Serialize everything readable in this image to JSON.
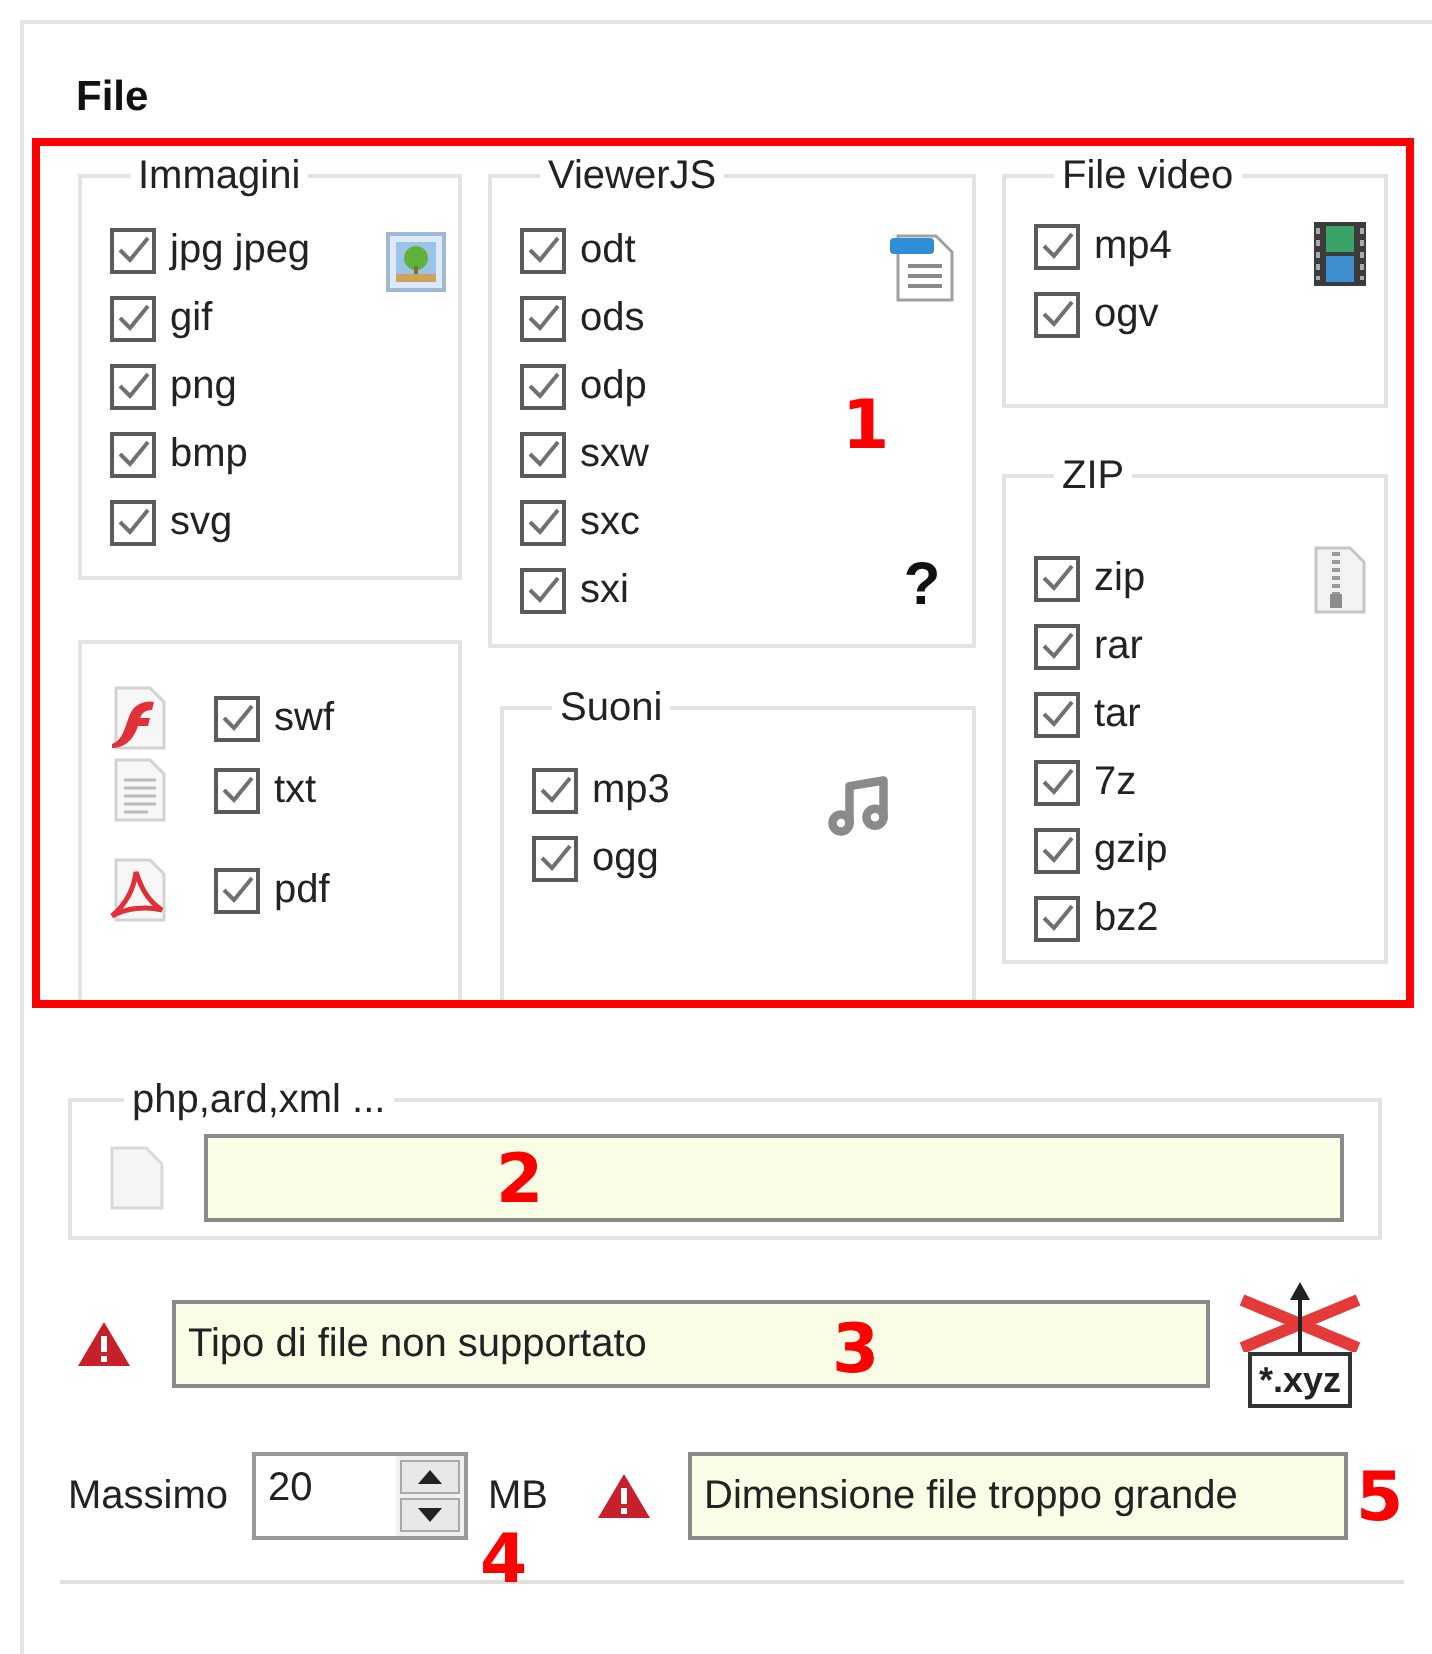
{
  "title": "File",
  "images": {
    "title": "Immagini",
    "items": [
      {
        "label": "jpg jpeg",
        "checked": true
      },
      {
        "label": "gif",
        "checked": true
      },
      {
        "label": "png",
        "checked": true
      },
      {
        "label": "bmp",
        "checked": true
      },
      {
        "label": "svg",
        "checked": true
      }
    ]
  },
  "viewerjs": {
    "title": "ViewerJS",
    "help_mark": "?",
    "items": [
      {
        "label": "odt",
        "checked": true
      },
      {
        "label": "ods",
        "checked": true
      },
      {
        "label": "odp",
        "checked": true
      },
      {
        "label": "sxw",
        "checked": true
      },
      {
        "label": "sxc",
        "checked": true
      },
      {
        "label": "sxi",
        "checked": true
      }
    ]
  },
  "video": {
    "title": "File video",
    "items": [
      {
        "label": "mp4",
        "checked": true
      },
      {
        "label": "ogv",
        "checked": true
      }
    ]
  },
  "misc": {
    "items": [
      {
        "label": "swf",
        "checked": true
      },
      {
        "label": "txt",
        "checked": true
      },
      {
        "label": "pdf",
        "checked": true
      }
    ]
  },
  "sounds": {
    "title": "Suoni",
    "items": [
      {
        "label": "mp3",
        "checked": true
      },
      {
        "label": "ogg",
        "checked": true
      }
    ]
  },
  "zip": {
    "title": "ZIP",
    "items": [
      {
        "label": "zip",
        "checked": true
      },
      {
        "label": "rar",
        "checked": true
      },
      {
        "label": "tar",
        "checked": true
      },
      {
        "label": "7z",
        "checked": true
      },
      {
        "label": "gzip",
        "checked": true
      },
      {
        "label": "bz2",
        "checked": true
      }
    ]
  },
  "custom_types": {
    "title": "php,ard,xml ..."
  },
  "unsupported_message": {
    "value": "Tipo di file non supportato"
  },
  "extension_badge": "*.xyz",
  "max_size": {
    "label": "Massimo",
    "value": "20",
    "unit": "MB"
  },
  "size_message": {
    "value": "Dimensione file troppo grande"
  },
  "annotations": [
    "1",
    "2",
    "3",
    "4",
    "5"
  ]
}
